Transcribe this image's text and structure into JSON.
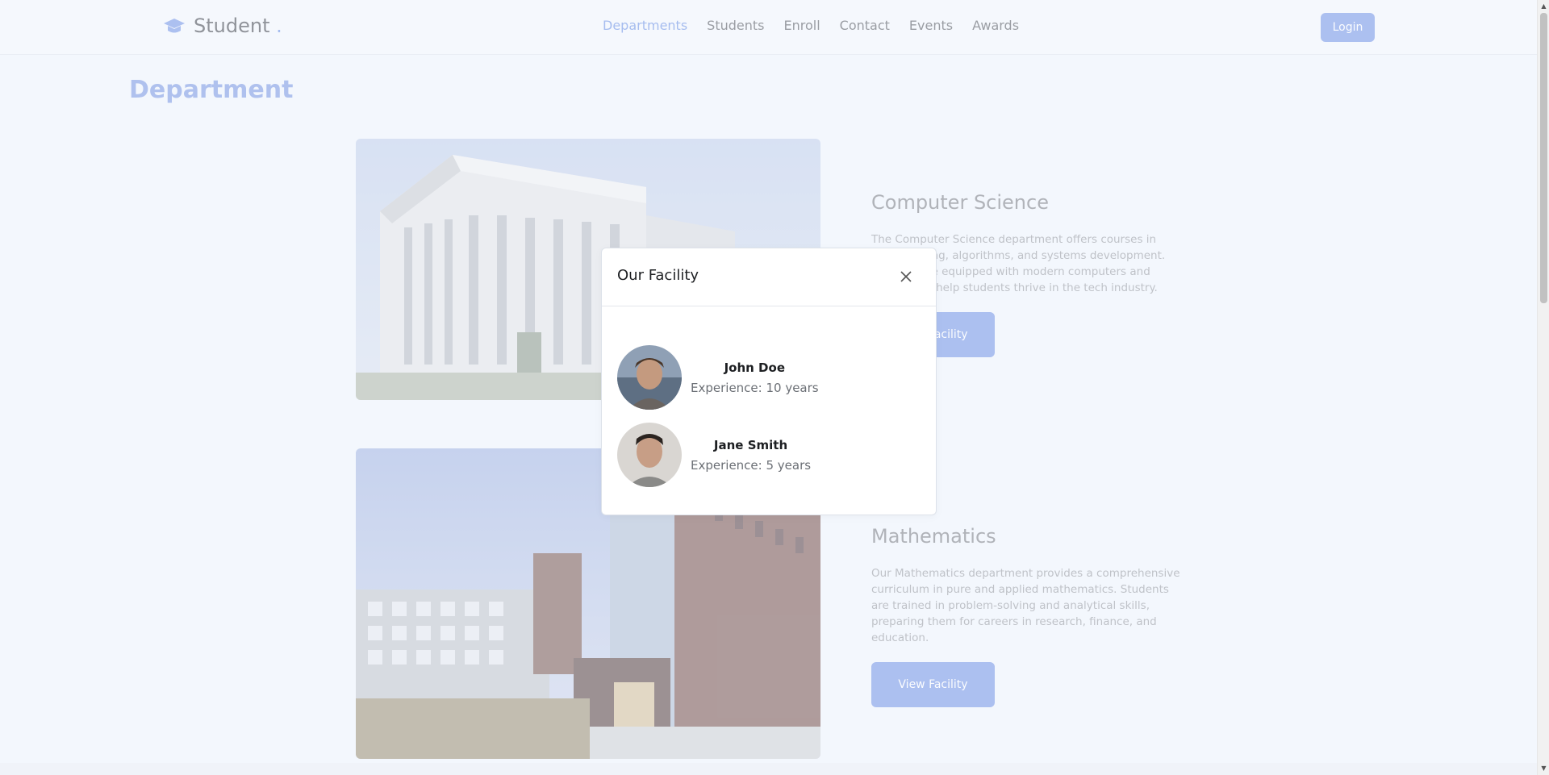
{
  "brand": {
    "name": "Student",
    "dot": "."
  },
  "nav": {
    "links": [
      "Departments",
      "Students",
      "Enroll",
      "Contact",
      "Events",
      "Awards"
    ],
    "login_label": "Login"
  },
  "page": {
    "title": "Department"
  },
  "departments": [
    {
      "name": "Computer Science",
      "description": "The Computer Science department offers courses in programming, algorithms, and systems development. Our labs are equipped with modern computers and software to help students thrive in the tech industry.",
      "button_label": "View Facility"
    },
    {
      "name": "Mathematics",
      "description": "Our Mathematics department provides a comprehensive curriculum in pure and applied mathematics. Students are trained in problem-solving and analytical skills, preparing them for careers in research, finance, and education.",
      "button_label": "View Facility"
    }
  ],
  "modal": {
    "title": "Our Facility",
    "members": [
      {
        "name": "John Doe",
        "experience": "Experience: 10 years"
      },
      {
        "name": "Jane Smith",
        "experience": "Experience: 5 years"
      }
    ]
  },
  "colors": {
    "accent": "#7d9ee8",
    "button": "#86a3ea"
  }
}
